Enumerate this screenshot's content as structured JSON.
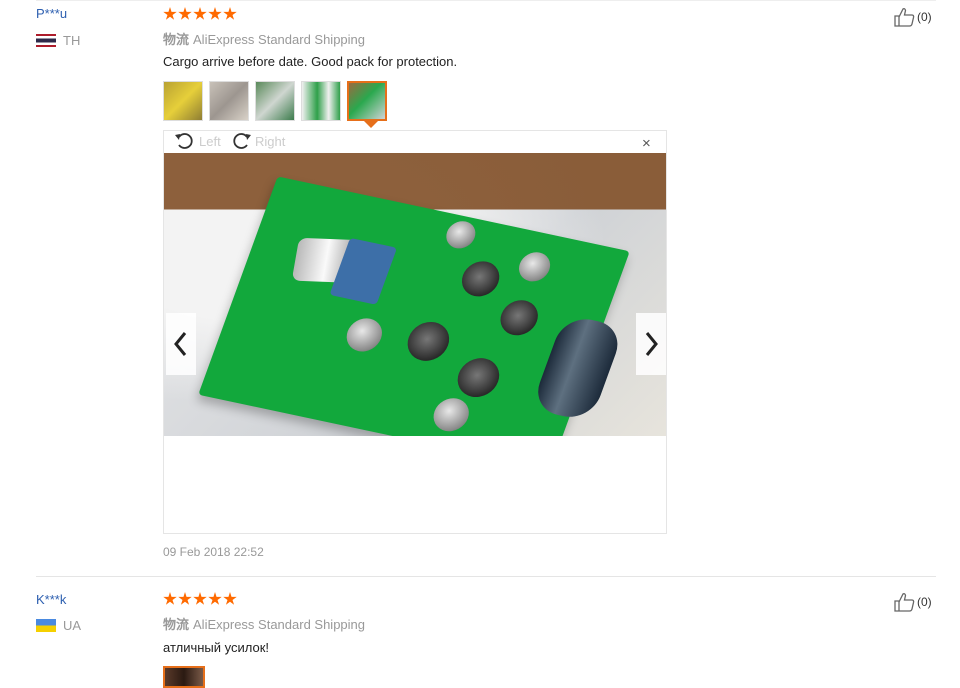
{
  "reviews": [
    {
      "user": "P***u",
      "country": "TH",
      "shipping_label": "物流",
      "shipping_method": "AliExpress Standard Shipping",
      "text": "Cargo arrive before date. Good pack for protection.",
      "likes": "(0)",
      "date": "09 Feb 2018 22:52",
      "rating": 5,
      "viewer": {
        "rotate_left": "Left",
        "rotate_right": "Right",
        "close": "×"
      }
    },
    {
      "user": "K***k",
      "country": "UA",
      "shipping_label": "物流",
      "shipping_method": "AliExpress Standard Shipping",
      "text": "атличный усилок!",
      "likes": "(0)",
      "rating": 5
    }
  ],
  "colors": {
    "accent": "#ff6a00",
    "username": "#2d5fb0",
    "muted": "#999999"
  },
  "icons": [
    "thumbs-up-icon",
    "rotate-left-icon",
    "rotate-right-icon",
    "close-icon",
    "chevron-left-icon",
    "chevron-right-icon",
    "star-icon"
  ]
}
